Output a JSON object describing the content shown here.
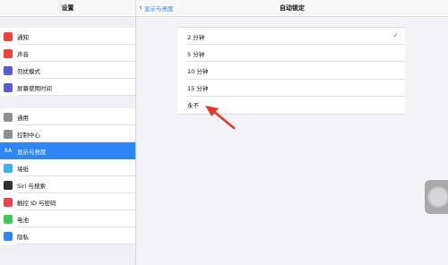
{
  "sidebar": {
    "title": "设置",
    "group1": [
      {
        "label": "通知",
        "icon": "notifications-icon",
        "color": "#f0413a"
      },
      {
        "label": "声音",
        "icon": "sounds-icon",
        "color": "#f0413a"
      },
      {
        "label": "勿扰模式",
        "icon": "moon-icon",
        "color": "#5b5bd6"
      },
      {
        "label": "屏幕使用时间",
        "icon": "hourglass-icon",
        "color": "#5b5bd6"
      }
    ],
    "group2": [
      {
        "label": "通用",
        "icon": "gear-icon",
        "color": "#8e8e93"
      },
      {
        "label": "控制中心",
        "icon": "control-center-icon",
        "color": "#8e8e93"
      },
      {
        "label": "显示与亮度",
        "icon": "display-brightness-icon",
        "color": "#2f86f6",
        "active": true,
        "glyph": "AA"
      },
      {
        "label": "墙纸",
        "icon": "wallpaper-icon",
        "color": "#37b4f0"
      },
      {
        "label": "Siri 与搜索",
        "icon": "siri-icon",
        "color": "#303030"
      },
      {
        "label": "触控 ID 与密码",
        "icon": "fingerprint-icon",
        "color": "#f0414e"
      },
      {
        "label": "电池",
        "icon": "battery-icon",
        "color": "#3fc95a"
      },
      {
        "label": "隐私",
        "icon": "hand-icon",
        "color": "#2f86f6"
      }
    ]
  },
  "nav": {
    "back_label": "显示与亮度",
    "title": "自动锁定"
  },
  "options": [
    {
      "label": "2 分钟",
      "selected": true
    },
    {
      "label": "5 分钟",
      "selected": false
    },
    {
      "label": "10 分钟",
      "selected": false
    },
    {
      "label": "15 分钟",
      "selected": false
    },
    {
      "label": "永不",
      "selected": false
    }
  ],
  "colors": {
    "accent": "#2f86f6",
    "annotation_arrow": "#e8372c"
  }
}
